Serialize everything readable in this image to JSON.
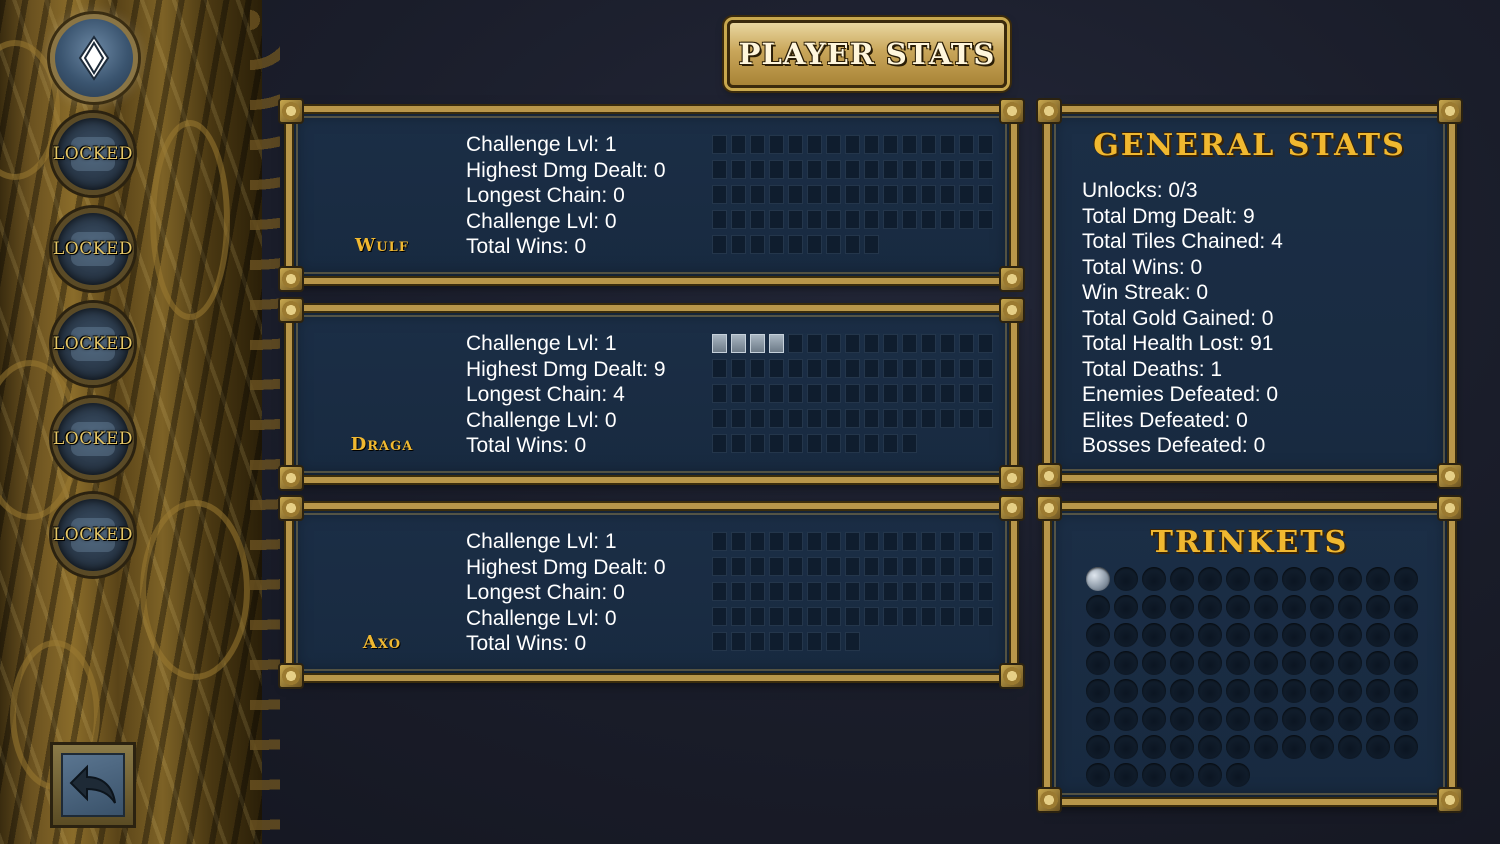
{
  "title": "PLAYER STATS",
  "sidebar": {
    "characters": [
      {
        "name": "active-character",
        "label": "",
        "locked": false
      },
      {
        "name": "locked-1",
        "label": "LOCKED",
        "locked": true
      },
      {
        "name": "locked-2",
        "label": "LOCKED",
        "locked": true
      },
      {
        "name": "locked-3",
        "label": "LOCKED",
        "locked": true
      },
      {
        "name": "locked-4",
        "label": "LOCKED",
        "locked": true
      },
      {
        "name": "locked-5",
        "label": "LOCKED",
        "locked": true
      }
    ],
    "back_icon": "back-arrow-icon"
  },
  "characters": [
    {
      "name": "Wulf",
      "stats": [
        "Challenge Lvl: 1",
        "Highest Dmg Dealt: 0",
        "Longest Chain: 0",
        "Challenge Lvl: 0",
        "Total Wins: 0"
      ],
      "tiles_total": 69,
      "tiles_filled": 0
    },
    {
      "name": "Draga",
      "stats": [
        "Challenge Lvl: 1",
        "Highest Dmg Dealt: 9",
        "Longest Chain: 4",
        "Challenge Lvl: 0",
        "Total Wins: 0"
      ],
      "tiles_total": 71,
      "tiles_filled": 4
    },
    {
      "name": "Axo",
      "stats": [
        "Challenge Lvl: 1",
        "Highest Dmg Dealt: 0",
        "Longest Chain: 0",
        "Challenge Lvl: 0",
        "Total Wins: 0"
      ],
      "tiles_total": 68,
      "tiles_filled": 0
    }
  ],
  "general": {
    "title": "GENERAL STATS",
    "stats": [
      "Unlocks: 0/3",
      "Total Dmg Dealt: 9",
      "Total Tiles Chained: 4",
      "Total Wins: 0",
      "Win Streak: 0",
      "Total Gold Gained: 0",
      "Total Health Lost: 91",
      "Total Deaths: 1",
      "Enemies Defeated: 0",
      "Elites Defeated: 0",
      "Bosses Defeated: 0"
    ]
  },
  "trinkets": {
    "title": "TRINKETS",
    "slots_total": 90,
    "slots_filled": 1
  },
  "colors": {
    "gold_text": "#f0b830",
    "panel_bg": "#1b2e46",
    "frame": "#b8964a",
    "background": "#1a1d2a"
  }
}
